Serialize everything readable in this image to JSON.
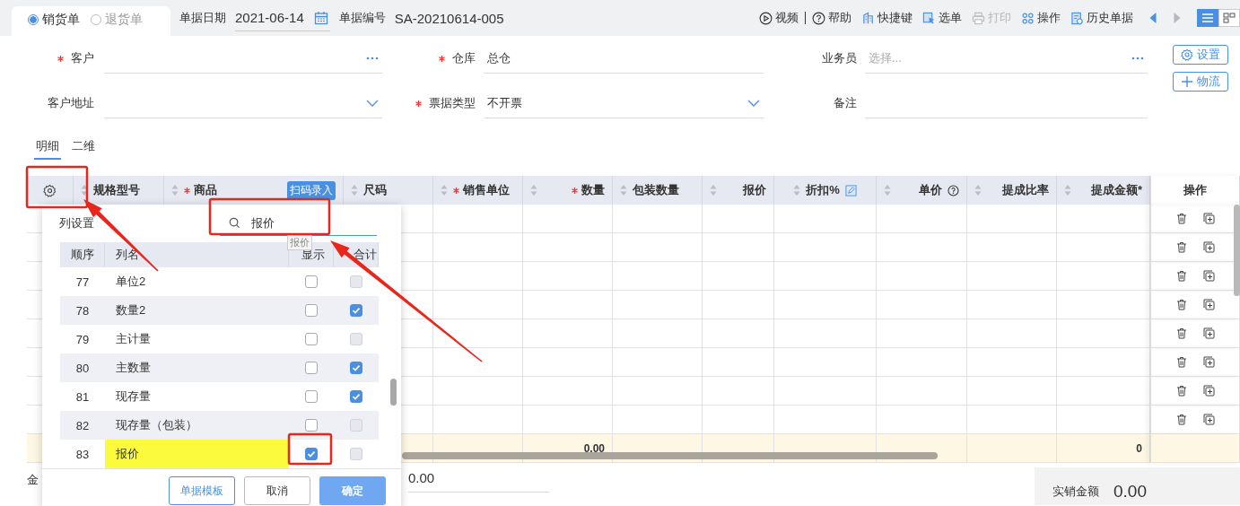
{
  "order_type": [
    {
      "label": "销货单",
      "selected": true
    },
    {
      "label": "退货单",
      "selected": false
    }
  ],
  "header_fields": [
    {
      "label": "单据日期",
      "value": "2021-06-14",
      "kind": "date"
    },
    {
      "label": "单据编号",
      "value": "SA-20210614-005",
      "kind": "text"
    }
  ],
  "toolbar": [
    {
      "label": "视频",
      "kind": "play",
      "disabled": false
    },
    {
      "label": "帮助",
      "kind": "help",
      "disabled": false
    },
    {
      "label": "快捷键",
      "kind": "keys",
      "disabled": false
    },
    {
      "label": "选单",
      "kind": "select",
      "disabled": false
    },
    {
      "label": "打印",
      "kind": "print",
      "disabled": true
    },
    {
      "label": "操作",
      "kind": "grid",
      "disabled": false
    },
    {
      "label": "历史单据",
      "kind": "history",
      "disabled": false
    }
  ],
  "nav_arrows": [
    {
      "kind": "prev",
      "disabled": false
    },
    {
      "kind": "next",
      "disabled": true
    }
  ],
  "view_toggle": [
    {
      "kind": "list",
      "selected": true
    },
    {
      "kind": "grid",
      "selected": false
    }
  ],
  "form_fields": [
    {
      "label": "客户",
      "required": true,
      "kind": "lookup"
    },
    {
      "label": "仓库",
      "required": true,
      "value": "总仓",
      "kind": "plain"
    },
    {
      "label": "业务员",
      "required": false,
      "placeholder": "选择...",
      "kind": "lookup"
    },
    {
      "label": "客户地址",
      "required": false,
      "kind": "dropdown"
    },
    {
      "label": "票据类型",
      "required": true,
      "value": "不开票",
      "kind": "dropdown"
    },
    {
      "label": "备注",
      "required": false,
      "kind": "plain"
    }
  ],
  "side_buttons": [
    {
      "label": "设置",
      "kind": "settings"
    },
    {
      "label": "物流",
      "kind": "add"
    }
  ],
  "detail_tabs": [
    {
      "label": "明细",
      "selected": true
    },
    {
      "label": "二维",
      "selected": false
    }
  ],
  "table": {
    "columns": [
      {
        "kind": "settings"
      },
      {
        "label": "规格型号",
        "kind": "data",
        "required": false
      },
      {
        "label": "商品",
        "kind": "data",
        "required": true,
        "badge": "扫码录入"
      },
      {
        "label": "尺码",
        "kind": "data",
        "required": false
      },
      {
        "label": "销售单位",
        "kind": "data",
        "required": true
      },
      {
        "label": "数量",
        "kind": "data",
        "required": true,
        "total": "0.00"
      },
      {
        "label": "包装数量",
        "kind": "data",
        "required": false
      },
      {
        "label": "报价",
        "kind": "data",
        "required": false
      },
      {
        "label": "折扣%",
        "kind": "editable",
        "required": false
      },
      {
        "label": "单价",
        "kind": "help",
        "required": false
      },
      {
        "label": "提成比率",
        "kind": "data",
        "required": false
      },
      {
        "label": "提成金额*",
        "kind": "data",
        "required": false,
        "total": "0"
      },
      {
        "label": "操作",
        "kind": "actions"
      }
    ],
    "rows": [
      {
        "kind": "empty"
      },
      {
        "kind": "empty"
      },
      {
        "kind": "empty"
      },
      {
        "kind": "empty"
      },
      {
        "kind": "empty"
      },
      {
        "kind": "empty"
      },
      {
        "kind": "empty"
      },
      {
        "kind": "empty"
      }
    ]
  },
  "column_settings": {
    "title": "列设置",
    "search": {
      "value": "报价"
    },
    "tooltip": "报价",
    "columns": [
      "顺序",
      "列名",
      "显示",
      "合计"
    ],
    "rows": [
      {
        "order": "77",
        "name": "单位2",
        "show": false,
        "total": false,
        "total_disabled": true,
        "highlighted": false
      },
      {
        "order": "78",
        "name": "数量2",
        "show": false,
        "total": true,
        "total_disabled": false,
        "highlighted": false
      },
      {
        "order": "79",
        "name": "主计量",
        "show": false,
        "total": false,
        "total_disabled": true,
        "highlighted": false
      },
      {
        "order": "80",
        "name": "主数量",
        "show": false,
        "total": true,
        "total_disabled": false,
        "highlighted": false
      },
      {
        "order": "81",
        "name": "现存量",
        "show": false,
        "total": true,
        "total_disabled": false,
        "highlighted": false
      },
      {
        "order": "82",
        "name": "现存量（包装）",
        "show": false,
        "total": false,
        "total_disabled": true,
        "highlighted": false
      },
      {
        "order": "83",
        "name": "报价",
        "show": true,
        "total": false,
        "total_disabled": true,
        "highlighted": true
      }
    ],
    "buttons": [
      {
        "label": "单据模板",
        "kind": "outline"
      },
      {
        "label": "取消",
        "kind": "default"
      },
      {
        "label": "确定",
        "kind": "primary"
      }
    ]
  },
  "footer": {
    "amount_label": "金",
    "amount_value": "0.00",
    "net_label": "实销金额",
    "net_value": "0.00"
  },
  "annotations": [
    {
      "kind": "box"
    },
    {
      "kind": "box"
    },
    {
      "kind": "box"
    },
    {
      "kind": "arrow"
    },
    {
      "kind": "arrow"
    }
  ]
}
